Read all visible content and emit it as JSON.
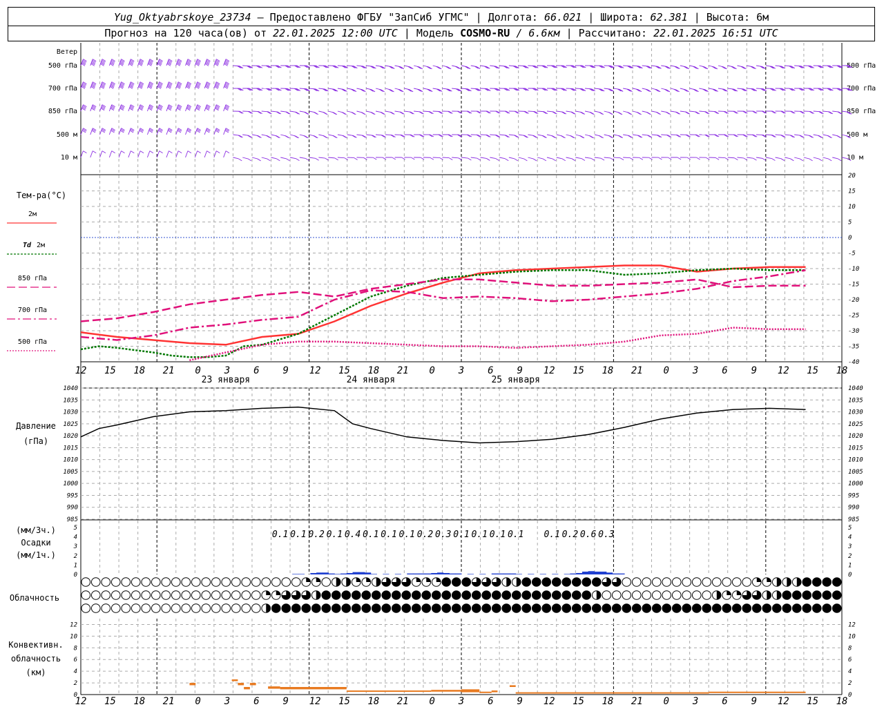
{
  "header": {
    "line1": {
      "station": "Yug_Oktyabrskoye_23734",
      "provided": "– Предоставлено ФГБУ \"ЗапСиб УГМС\"",
      "lon_label": "| Долгота:",
      "lon": "66.021",
      "lat_label": "| Широта:",
      "lat": "62.381",
      "alt_label": "| Высота:",
      "alt": "6м"
    },
    "line2": {
      "forecast": "Прогноз на 120 часа(ов) от",
      "init": "22.01.2025 12:00 UTC",
      "model_label": "| Модель",
      "model": "COSMO-RU",
      "res": "/ 6.6км",
      "calc_label": "| Рассчитано:",
      "calc": "22.01.2025 16:51 UTC"
    }
  },
  "colors": {
    "wind": "#8a2be2",
    "t2m": "#ff3333",
    "td2m": "#007700",
    "t850": "#e0107a",
    "t700": "#e0107a",
    "t500": "#e0107a",
    "pressure": "#000000",
    "precip": "#1f3fd0",
    "convective": "#e87a20",
    "grid": "#aaaaaa"
  },
  "chart_data": [
    {
      "type": "wind-barbs",
      "title": "Ветер",
      "levels": [
        "500 гПа",
        "700 гПа",
        "850 гПа",
        "500 м",
        "10 м"
      ]
    },
    {
      "type": "line",
      "title": "Тем-ра(°C)",
      "ylim": [
        -40,
        20
      ],
      "yticks": [
        20,
        15,
        10,
        5,
        0,
        -5,
        -10,
        -15,
        -20,
        -25,
        -30,
        -35,
        -40
      ],
      "x_tick_labels": [
        "12",
        "15",
        "18",
        "21",
        "0",
        "3",
        "6",
        "9",
        "12",
        "15",
        "18",
        "21",
        "0",
        "3",
        "6",
        "9",
        "12",
        "15",
        "18",
        "21",
        "0",
        "3",
        "6",
        "9",
        "12",
        "15",
        "18"
      ],
      "day_labels": [
        {
          "hour": 24,
          "text": "23 января"
        },
        {
          "hour": 48,
          "text": "24 января"
        },
        {
          "hour": 72,
          "text": "25 января"
        }
      ],
      "series": [
        {
          "name": "2м",
          "hour": [
            0,
            6,
            12,
            18,
            24,
            30,
            36,
            42,
            48,
            54,
            60,
            66,
            72,
            78,
            84,
            90,
            96,
            102,
            108,
            114,
            120
          ],
          "values": [
            -30.5,
            -32,
            -33,
            -34,
            -34.5,
            -32,
            -31,
            -27,
            -22,
            -18,
            -14.5,
            -11.5,
            -10.5,
            -10,
            -9.5,
            -9,
            -9,
            -11,
            -10,
            -9.5,
            -9.5
          ]
        },
        {
          "name": "Td 2м",
          "hour": [
            0,
            3,
            6,
            12,
            15,
            18,
            21,
            24,
            27,
            30,
            36,
            42,
            48,
            54,
            60,
            66,
            72,
            78,
            84,
            90,
            96,
            102,
            108,
            114,
            120
          ],
          "values": [
            -36,
            -35,
            -35.5,
            -37,
            -38,
            -38.5,
            -38.5,
            -38,
            -35,
            -34.5,
            -31,
            -25,
            -19,
            -15.5,
            -13,
            -12,
            -11,
            -10.5,
            -10.5,
            -12,
            -11.5,
            -10.5,
            -10,
            -10.5,
            -10.5
          ]
        },
        {
          "name": "850 гПа",
          "hour": [
            0,
            6,
            12,
            18,
            24,
            30,
            36,
            42,
            48,
            54,
            60,
            66,
            72,
            78,
            84,
            90,
            96,
            102,
            108,
            114,
            120
          ],
          "values": [
            -27,
            -26,
            -24,
            -21.5,
            -20,
            -18.5,
            -17.5,
            -19,
            -16.5,
            -15,
            -13.5,
            -13.5,
            -14.5,
            -15.5,
            -15.5,
            -15,
            -14.5,
            -13.5,
            -16,
            -15.5,
            -15.5
          ]
        },
        {
          "name": "700 гПа",
          "hour": [
            0,
            6,
            12,
            18,
            24,
            30,
            36,
            42,
            48,
            54,
            60,
            66,
            72,
            78,
            84,
            90,
            96,
            102,
            108,
            114,
            120
          ],
          "values": [
            -32,
            -33,
            -31.5,
            -29,
            -28,
            -26.5,
            -25.5,
            -20,
            -17,
            -17.5,
            -19.5,
            -19,
            -19.5,
            -20.5,
            -20,
            -19,
            -18,
            -16.5,
            -14,
            -12.5,
            -10.5
          ]
        },
        {
          "name": "500 гПа",
          "hour": [
            0,
            6,
            12,
            18,
            24,
            30,
            36,
            42,
            48,
            54,
            60,
            66,
            72,
            78,
            84,
            90,
            96,
            102,
            108,
            114,
            120
          ],
          "values": [
            null,
            null,
            null,
            -39.5,
            -37,
            -34.5,
            -33.5,
            -33.5,
            -34,
            -34.5,
            -35,
            -35,
            -35.5,
            -35,
            -34.5,
            -33.5,
            -31.5,
            -31,
            -29,
            -29.5,
            -29.5
          ]
        }
      ]
    },
    {
      "type": "line",
      "title": "Давление",
      "ylabel": "(гПа)",
      "ylim": [
        985,
        1040
      ],
      "yticks": [
        1040,
        1035,
        1030,
        1025,
        1020,
        1015,
        1010,
        1005,
        1000,
        995,
        990,
        985
      ],
      "series": [
        {
          "name": "Давление",
          "hour": [
            0,
            3,
            6,
            12,
            18,
            24,
            30,
            36,
            42,
            45,
            48,
            54,
            60,
            66,
            72,
            78,
            84,
            90,
            96,
            102,
            108,
            114,
            120
          ],
          "values": [
            1019.5,
            1023,
            1024.5,
            1028,
            1030,
            1030.5,
            1031.5,
            1032,
            1030.5,
            1025,
            1023,
            1019.5,
            1018,
            1017,
            1017.5,
            1018.5,
            1020.5,
            1023.5,
            1027,
            1029.5,
            1031,
            1031.5,
            1031
          ]
        }
      ]
    },
    {
      "type": "bar",
      "title": "Осадки",
      "ylabel_3h": "(мм/3ч.)",
      "ylabel_1h": "(мм/1ч.)",
      "yticks": [
        5,
        4,
        3,
        2,
        1,
        0
      ],
      "labels_3h": [
        {
          "hour": 33,
          "text": "0.1"
        },
        {
          "hour": 36,
          "text": "0.1"
        },
        {
          "hour": 39,
          "text": "0.2"
        },
        {
          "hour": 42,
          "text": "0.1"
        },
        {
          "hour": 45,
          "text": "0.4"
        },
        {
          "hour": 48,
          "text": "0.1"
        },
        {
          "hour": 51,
          "text": "0.1"
        },
        {
          "hour": 54,
          "text": "0.1"
        },
        {
          "hour": 57,
          "text": "0.2"
        },
        {
          "hour": 60,
          "text": "0.3"
        },
        {
          "hour": 63,
          "text": "0.1"
        },
        {
          "hour": 66,
          "text": "0.1"
        },
        {
          "hour": 69,
          "text": "0.1"
        },
        {
          "hour": 72,
          "text": "0.1"
        },
        {
          "hour": 78,
          "text": "0.1"
        },
        {
          "hour": 81,
          "text": "0.2"
        },
        {
          "hour": 84,
          "text": "0.6"
        },
        {
          "hour": 87,
          "text": "0.3"
        }
      ],
      "hourly_mm": [
        {
          "hour": 35,
          "v": 0.05
        },
        {
          "hour": 36,
          "v": 0.05
        },
        {
          "hour": 38,
          "v": 0.15
        },
        {
          "hour": 39,
          "v": 0.2
        },
        {
          "hour": 40,
          "v": 0.2
        },
        {
          "hour": 41,
          "v": 0.1
        },
        {
          "hour": 42,
          "v": 0.05
        },
        {
          "hour": 43,
          "v": 0.1
        },
        {
          "hour": 44,
          "v": 0.15
        },
        {
          "hour": 45,
          "v": 0.25
        },
        {
          "hour": 46,
          "v": 0.25
        },
        {
          "hour": 47,
          "v": 0.2
        },
        {
          "hour": 48,
          "v": 0.05
        },
        {
          "hour": 50,
          "v": 0.05
        },
        {
          "hour": 52,
          "v": 0.05
        },
        {
          "hour": 54,
          "v": 0.1
        },
        {
          "hour": 55,
          "v": 0.1
        },
        {
          "hour": 56,
          "v": 0.1
        },
        {
          "hour": 57,
          "v": 0.1
        },
        {
          "hour": 58,
          "v": 0.15
        },
        {
          "hour": 59,
          "v": 0.2
        },
        {
          "hour": 60,
          "v": 0.15
        },
        {
          "hour": 61,
          "v": 0.1
        },
        {
          "hour": 62,
          "v": 0.1
        },
        {
          "hour": 64,
          "v": 0.05
        },
        {
          "hour": 66,
          "v": 0.05
        },
        {
          "hour": 68,
          "v": 0.1
        },
        {
          "hour": 69,
          "v": 0.1
        },
        {
          "hour": 70,
          "v": 0.1
        },
        {
          "hour": 71,
          "v": 0.1
        },
        {
          "hour": 72,
          "v": 0.05
        },
        {
          "hour": 74,
          "v": 0.05
        },
        {
          "hour": 76,
          "v": 0.05
        },
        {
          "hour": 78,
          "v": 0.05
        },
        {
          "hour": 80,
          "v": 0.05
        },
        {
          "hour": 81,
          "v": 0.1
        },
        {
          "hour": 82,
          "v": 0.15
        },
        {
          "hour": 83,
          "v": 0.3
        },
        {
          "hour": 84,
          "v": 0.35
        },
        {
          "hour": 85,
          "v": 0.3
        },
        {
          "hour": 86,
          "v": 0.3
        },
        {
          "hour": 87,
          "v": 0.2
        },
        {
          "hour": 88,
          "v": 0.1
        },
        {
          "hour": 89,
          "v": 0.1
        }
      ]
    },
    {
      "type": "cloud-symbols",
      "title": "Облачность",
      "symbols_per_row": 76,
      "note": "cover fraction 0..1 per symbol, rows top→bottom",
      "rows": [
        {
          "segments": [
            {
              "from": 0,
              "to": 21,
              "v": 0
            },
            {
              "from": 22,
              "to": 23,
              "v": 0.25
            },
            {
              "from": 24,
              "to": 24,
              "v": 0
            },
            {
              "from": 25,
              "to": 26,
              "v": 0.5
            },
            {
              "from": 27,
              "to": 28,
              "v": 0.25
            },
            {
              "from": 29,
              "to": 29,
              "v": 0.5
            },
            {
              "from": 30,
              "to": 32,
              "v": 0.75
            },
            {
              "from": 33,
              "to": 35,
              "v": 0.25
            },
            {
              "from": 36,
              "to": 38,
              "v": 1
            },
            {
              "from": 39,
              "to": 41,
              "v": 0.75
            },
            {
              "from": 42,
              "to": 43,
              "v": 0.5
            },
            {
              "from": 44,
              "to": 51,
              "v": 1
            },
            {
              "from": 52,
              "to": 53,
              "v": 0.75
            },
            {
              "from": 54,
              "to": 66,
              "v": 0
            },
            {
              "from": 67,
              "to": 68,
              "v": 0.25
            },
            {
              "from": 69,
              "to": 71,
              "v": 0.5
            },
            {
              "from": 72,
              "to": 75,
              "v": 1
            }
          ]
        },
        {
          "segments": [
            {
              "from": 0,
              "to": 17,
              "v": 0
            },
            {
              "from": 18,
              "to": 19,
              "v": 0.25
            },
            {
              "from": 20,
              "to": 22,
              "v": 0.75
            },
            {
              "from": 23,
              "to": 23,
              "v": 0.5
            },
            {
              "from": 24,
              "to": 50,
              "v": 1
            },
            {
              "from": 51,
              "to": 51,
              "v": 0.5
            },
            {
              "from": 52,
              "to": 62,
              "v": 0
            },
            {
              "from": 63,
              "to": 63,
              "v": 0.5
            },
            {
              "from": 64,
              "to": 65,
              "v": 0.25
            },
            {
              "from": 66,
              "to": 67,
              "v": 0.75
            },
            {
              "from": 68,
              "to": 69,
              "v": 0.5
            },
            {
              "from": 70,
              "to": 75,
              "v": 1
            }
          ]
        },
        {
          "segments": [
            {
              "from": 0,
              "to": 17,
              "v": 0
            },
            {
              "from": 18,
              "to": 18,
              "v": 0.5
            },
            {
              "from": 19,
              "to": 75,
              "v": 1
            }
          ]
        }
      ]
    },
    {
      "type": "bar",
      "title": "Конвективн. облачность",
      "ylabel": "(км)",
      "ylim": [
        0,
        13
      ],
      "yticks": [
        12,
        10,
        8,
        6,
        4,
        2,
        0
      ],
      "segments": [
        {
          "h0": 18,
          "h1": 19,
          "base": 1.6,
          "top": 2.0
        },
        {
          "h0": 25,
          "h1": 26,
          "base": 2.3,
          "top": 2.6
        },
        {
          "h0": 26,
          "h1": 27,
          "base": 1.6,
          "top": 2.0
        },
        {
          "h0": 27,
          "h1": 28,
          "base": 0.9,
          "top": 1.3
        },
        {
          "h0": 28,
          "h1": 29,
          "base": 1.6,
          "top": 2.0
        },
        {
          "h0": 31,
          "h1": 33,
          "base": 1.0,
          "top": 1.4
        },
        {
          "h0": 33,
          "h1": 44,
          "base": 0.9,
          "top": 1.3
        },
        {
          "h0": 44,
          "h1": 58,
          "base": 0.5,
          "top": 0.7
        },
        {
          "h0": 58,
          "h1": 63,
          "base": 0.5,
          "top": 0.8
        },
        {
          "h0": 63,
          "h1": 66,
          "base": 0.4,
          "top": 0.9
        },
        {
          "h0": 66,
          "h1": 68,
          "base": 0.3,
          "top": 0.5
        },
        {
          "h0": 68,
          "h1": 69,
          "base": 0.4,
          "top": 0.7
        },
        {
          "h0": 71,
          "h1": 72,
          "base": 1.3,
          "top": 1.6
        },
        {
          "h0": 72,
          "h1": 104,
          "base": 0.2,
          "top": 0.4
        },
        {
          "h0": 104,
          "h1": 120,
          "base": 0.3,
          "top": 0.5
        }
      ]
    }
  ],
  "legend": {
    "temp_title": "Тем-ра(°C)",
    "t2m": "2м",
    "td2m_a": "Td",
    "td2m_b": "2м",
    "t850": "850 гПа",
    "t700": "700 гПа",
    "t500": "500 гПа",
    "wind_title": "Ветер",
    "pressure_title": "Давление",
    "pressure_unit": "(гПа)",
    "precip_3h": "(мм/3ч.)",
    "precip_title": "Осадки",
    "precip_1h": "(мм/1ч.)",
    "cloud_title": "Облачность",
    "conv_1": "Конвективн.",
    "conv_2": "облачность",
    "conv_3": "(км)",
    "wind_levels_left": [
      "500 гПа",
      "700 гПа",
      "850 гПа",
      "500 м",
      "10 м"
    ],
    "wind_levels_right": [
      "500 гПа",
      "700 гПа",
      "850 гПа",
      "500 м",
      "10 м"
    ]
  }
}
